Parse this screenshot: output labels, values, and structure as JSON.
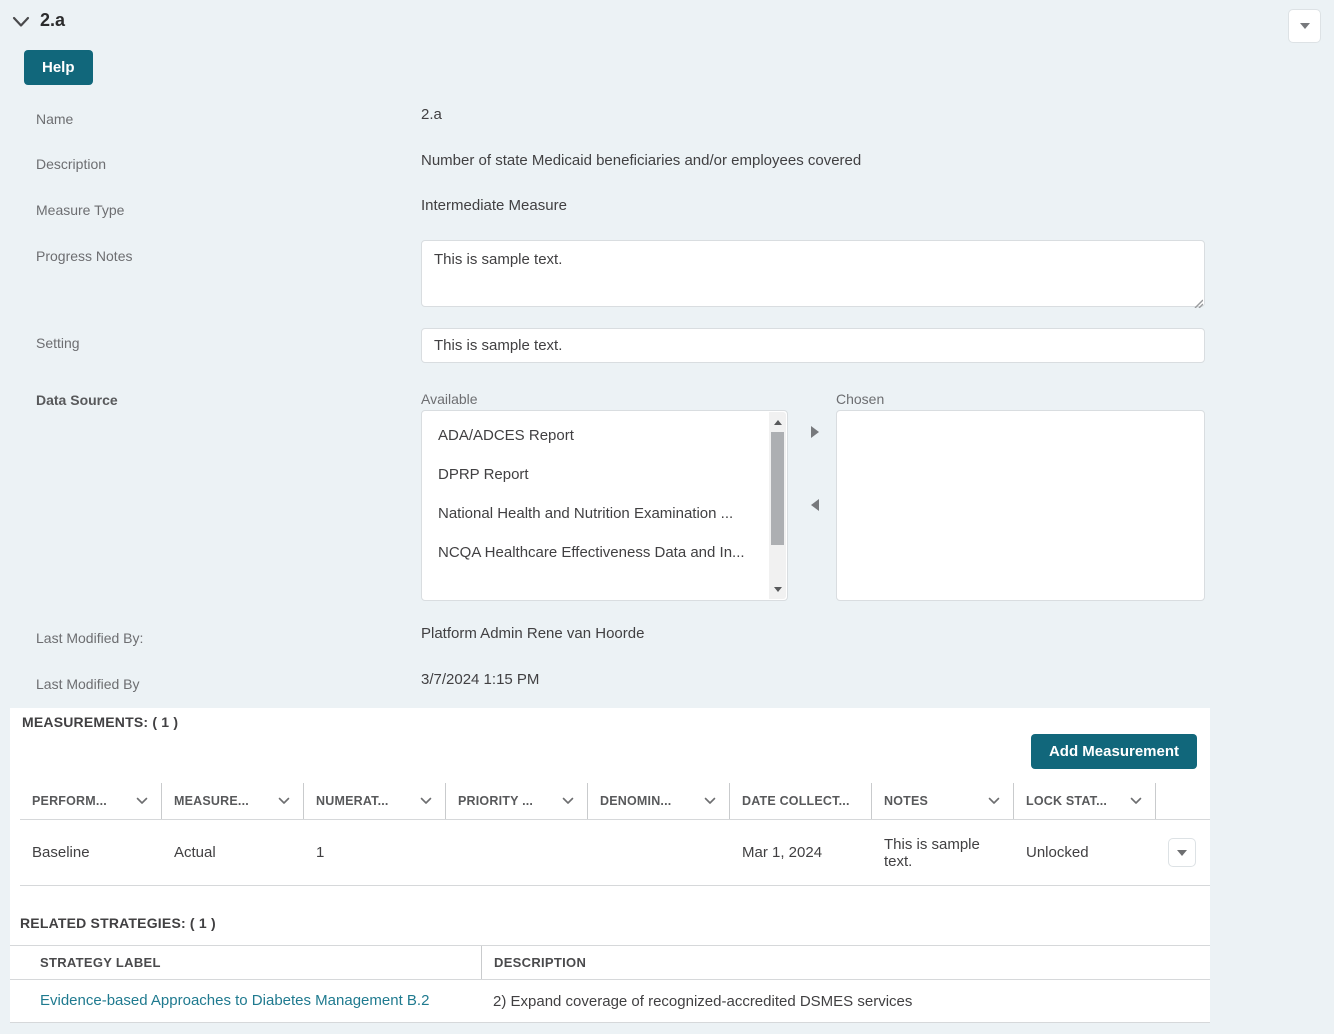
{
  "header": {
    "title": "2.a",
    "help_label": "Help"
  },
  "fields": {
    "name": {
      "label": "Name",
      "value": "2.a"
    },
    "description": {
      "label": "Description",
      "value": "Number of state Medicaid beneficiaries and/or employees covered"
    },
    "measure_type": {
      "label": "Measure Type",
      "value": "Intermediate Measure"
    },
    "progress_notes": {
      "label": "Progress Notes",
      "value": "This is sample text."
    },
    "setting": {
      "label": "Setting",
      "value": "This is sample text."
    },
    "data_source": {
      "label": "Data Source",
      "available_label": "Available",
      "chosen_label": "Chosen",
      "available_items": [
        "ADA/ADCES Report",
        "DPRP Report",
        "National Health and Nutrition Examination ...",
        "NCQA Healthcare Effectiveness Data and In..."
      ],
      "chosen_items": []
    },
    "last_modified_by_user": {
      "label": "Last Modified By:",
      "value": "Platform Admin Rene van Hoorde"
    },
    "last_modified_by_date": {
      "label": "Last Modified By",
      "value": "3/7/2024 1:15 PM"
    }
  },
  "measurements": {
    "title": "MEASUREMENTS: ( 1 )",
    "add_button_label": "Add Measurement",
    "columns": {
      "performance": "PERFORM...",
      "measure": "MEASURE...",
      "numerator": "NUMERAT...",
      "priority": "PRIORITY ...",
      "denominator": "DENOMIN...",
      "date_collected": "DATE COLLECT...",
      "notes": "NOTES",
      "lock_status": "LOCK STAT..."
    },
    "rows": [
      {
        "performance": "Baseline",
        "measure": "Actual",
        "numerator": "1",
        "priority": "",
        "denominator": "",
        "date_collected": "Mar 1, 2024",
        "notes": "This is sample text.",
        "lock_status": "Unlocked"
      }
    ]
  },
  "related_strategies": {
    "title": "RELATED STRATEGIES: ( 1 )",
    "columns": {
      "strategy_label": "STRATEGY LABEL",
      "description": "DESCRIPTION"
    },
    "rows": [
      {
        "strategy_label": "Evidence-based Approaches to Diabetes Management B.2",
        "description": "2) Expand coverage of recognized-accredited DSMES services"
      }
    ]
  },
  "colors": {
    "accent_teal": "#11677b",
    "link_teal": "#1f7a8f",
    "page_background": "#ecf2f5",
    "panel_background": "#ffffff"
  }
}
